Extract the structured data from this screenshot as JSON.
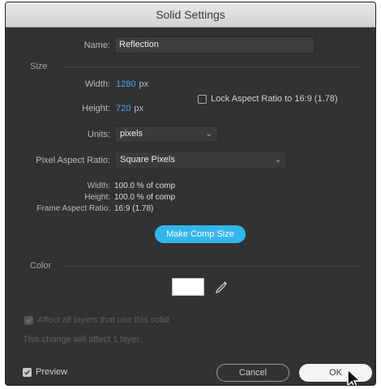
{
  "window": {
    "title": "Solid Settings"
  },
  "name": {
    "label": "Name:",
    "value": "Reflection"
  },
  "size": {
    "section_label": "Size",
    "width_label": "Width:",
    "width_value": "1280",
    "width_unit": "px",
    "height_label": "Height:",
    "height_value": "720",
    "height_unit": "px",
    "lock_label": "Lock Aspect Ratio to 16:9 (1.78)",
    "lock_checked": false,
    "units_label": "Units:",
    "units_value": "pixels",
    "par_label": "Pixel Aspect Ratio:",
    "par_value": "Square Pixels",
    "comp_width_label": "Width:",
    "comp_width_value": "100.0 % of comp",
    "comp_height_label": "Height:",
    "comp_height_value": "100.0 % of comp",
    "frame_aspect_label": "Frame Aspect Ratio:",
    "frame_aspect_value": "16:9 (1.78)",
    "make_comp_button": "Make Comp Size"
  },
  "color": {
    "section_label": "Color",
    "swatch_color": "#ffffff"
  },
  "affect": {
    "label": "Affect all layers that use this solid",
    "checked": true,
    "enabled": false,
    "note": "This change will affect 1 layer."
  },
  "footer": {
    "preview_label": "Preview",
    "preview_checked": true,
    "cancel_label": "Cancel",
    "ok_label": "OK"
  },
  "colors": {
    "dialog_bg": "#323232",
    "accent_blue": "#32b6ec",
    "value_blue": "#4aa3f0"
  }
}
